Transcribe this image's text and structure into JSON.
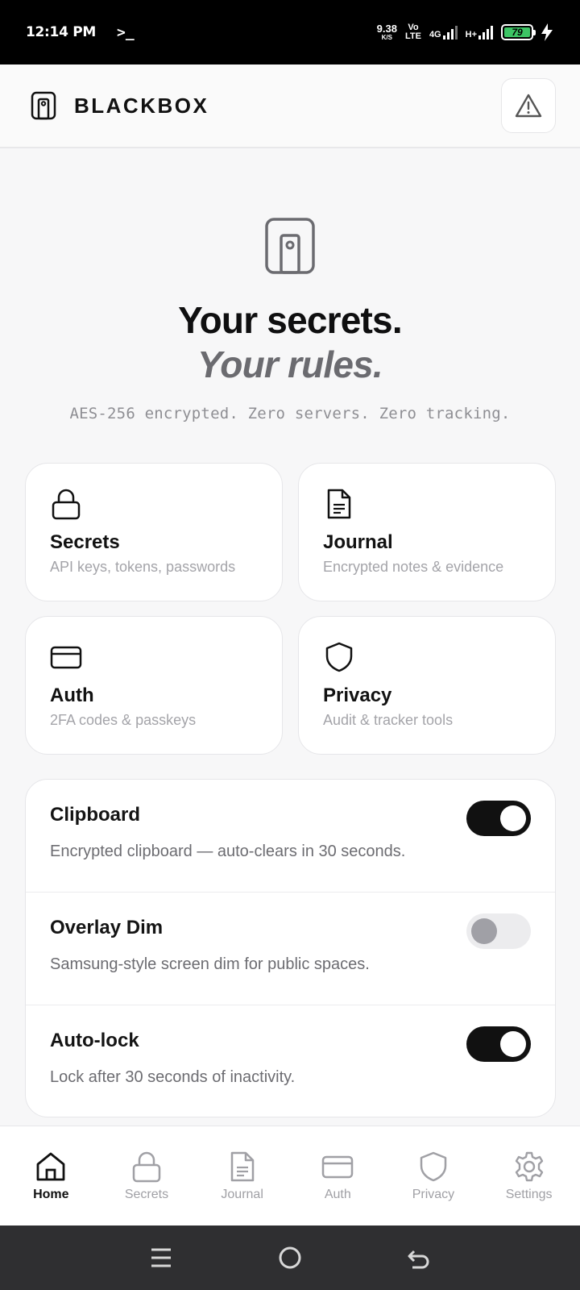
{
  "status_bar": {
    "time": "12:14 PM",
    "terminal_glyph": ">_",
    "speed_value": "9.38",
    "speed_unit": "K/S",
    "volte_top": "Vo",
    "volte_bottom": "LTE",
    "net_type_1": "4G",
    "net_type_2": "H+",
    "battery_level": "79",
    "battery_color": "#3cc464"
  },
  "header": {
    "title": "BLACKBOX",
    "logo_icon": "vault-icon",
    "alert_icon": "warning-icon"
  },
  "hero": {
    "headline": "Your secrets.",
    "tagline": "Your rules.",
    "subtitle": "AES-256 encrypted. Zero servers. Zero tracking."
  },
  "features": [
    {
      "title": "Secrets",
      "subtitle": "API keys, tokens, passwords",
      "icon": "lock-icon"
    },
    {
      "title": "Journal",
      "subtitle": "Encrypted notes & evidence",
      "icon": "document-icon"
    },
    {
      "title": "Auth",
      "subtitle": "2FA codes & passkeys",
      "icon": "card-icon"
    },
    {
      "title": "Privacy",
      "subtitle": "Audit & tracker tools",
      "icon": "shield-icon"
    }
  ],
  "toggles": [
    {
      "title": "Clipboard",
      "description": "Encrypted clipboard — auto-clears in 30 seconds.",
      "enabled": true
    },
    {
      "title": "Overlay Dim",
      "description": "Samsung-style screen dim for public spaces.",
      "enabled": false
    },
    {
      "title": "Auto-lock",
      "description": "Lock after 30 seconds of inactivity.",
      "enabled": true
    }
  ],
  "bottom_nav": [
    {
      "label": "Home",
      "icon": "home-icon",
      "active": true
    },
    {
      "label": "Secrets",
      "icon": "lock-icon",
      "active": false
    },
    {
      "label": "Journal",
      "icon": "document-icon",
      "active": false
    },
    {
      "label": "Auth",
      "icon": "card-icon",
      "active": false
    },
    {
      "label": "Privacy",
      "icon": "shield-icon",
      "active": false
    },
    {
      "label": "Settings",
      "icon": "gear-icon",
      "active": false
    }
  ],
  "system_nav": {
    "recents_icon": "recents-icon",
    "home_icon": "circle-home-icon",
    "back_icon": "back-icon"
  },
  "colors": {
    "accent": "#111111",
    "muted": "#a0a0a5",
    "tagline": "#6b6b70"
  }
}
